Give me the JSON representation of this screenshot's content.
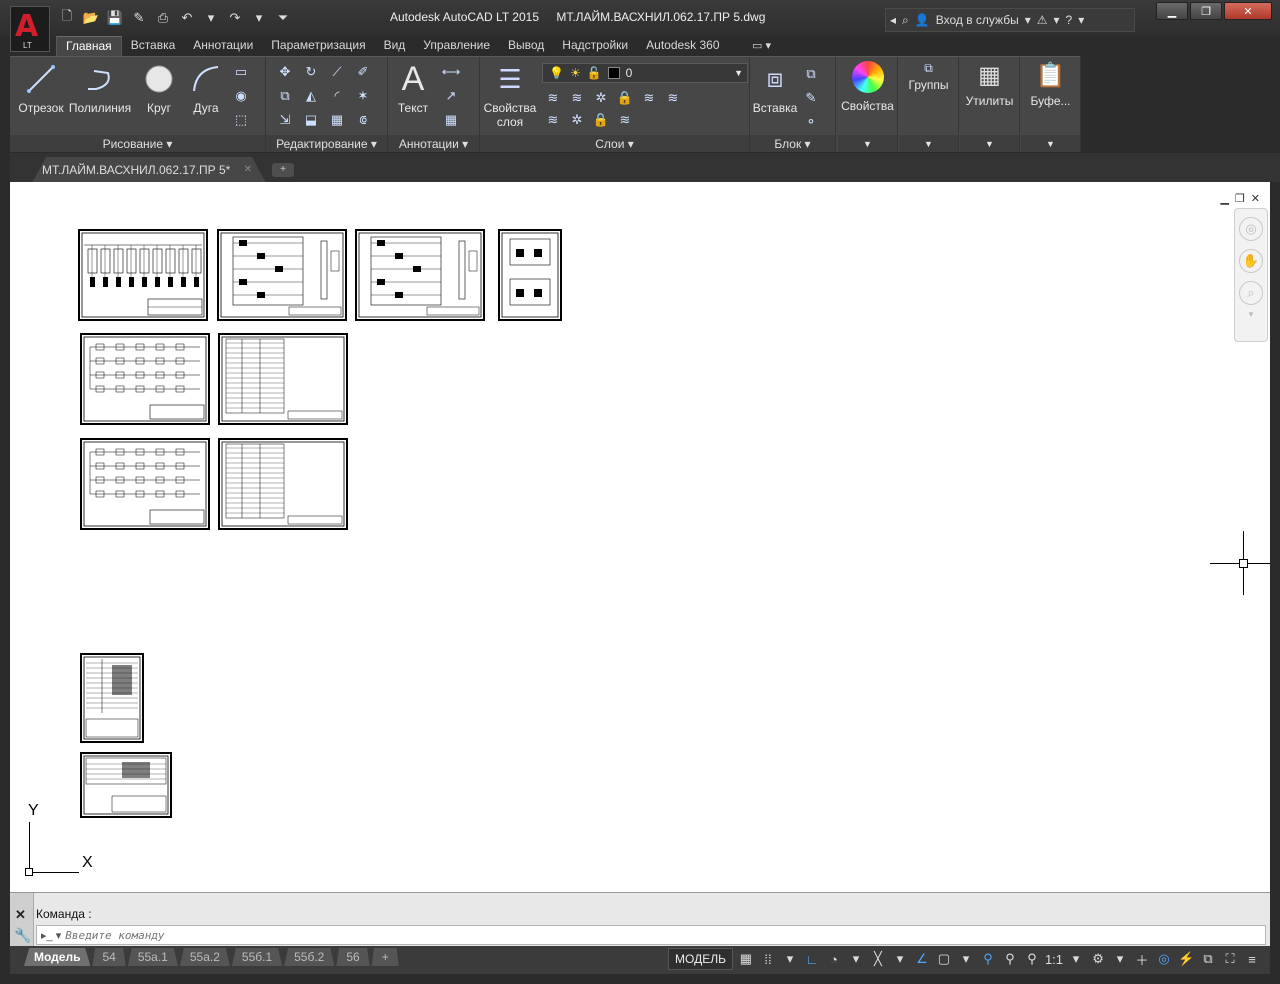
{
  "title": {
    "app": "Autodesk AutoCAD LT 2015",
    "file": "МТ.ЛАЙМ.ВАСХНИЛ.062.17.ПР 5.dwg",
    "login": "Вход в службы",
    "logo_letter": "A",
    "logo_sub": "LT"
  },
  "ribbon_tabs": [
    "Главная",
    "Вставка",
    "Аннотации",
    "Параметризация",
    "Вид",
    "Управление",
    "Вывод",
    "Надстройки",
    "Autodesk 360"
  ],
  "draw_panel": {
    "title": "Рисование",
    "tools": [
      "Отрезок",
      "Полилиния",
      "Круг",
      "Дуга"
    ]
  },
  "modify_panel": {
    "title": "Редактирование"
  },
  "annot_panel": {
    "title": "Аннотации",
    "text_tool": "Текст"
  },
  "layers_panel": {
    "title": "Слои",
    "props": "Свойства",
    "props2": "слоя",
    "current_layer": "0"
  },
  "block_panel": {
    "title": "Блок",
    "insert": "Вставка"
  },
  "extra_panels": [
    "Свойства",
    "Группы",
    "Утилиты",
    "Буфе..."
  ],
  "doc_tab": "МТ.ЛАЙМ.ВАСХНИЛ.062.17.ПР 5*",
  "ucs": {
    "x": "X",
    "y": "Y"
  },
  "command": {
    "history": "Команда :",
    "placeholder": "Введите команду"
  },
  "layout_tabs": [
    "Модель",
    "54",
    "55а.1",
    "55а.2",
    "55б.1",
    "55б.2",
    "56"
  ],
  "status": {
    "model": "МОДЕЛЬ",
    "scale": "1:1"
  }
}
